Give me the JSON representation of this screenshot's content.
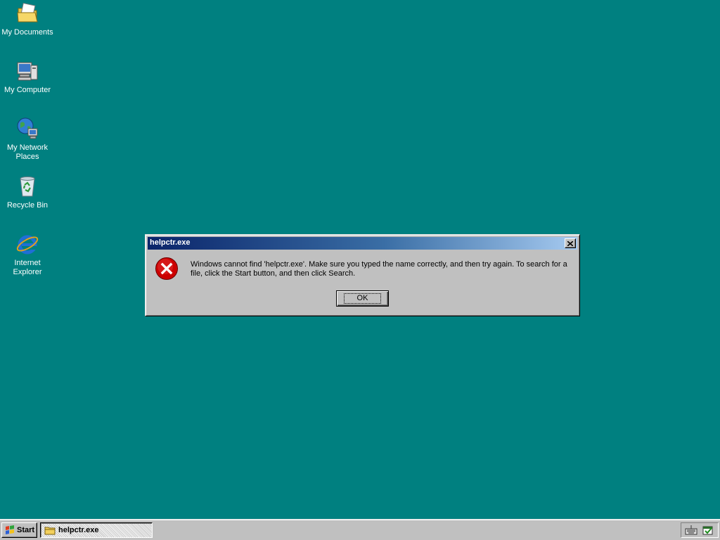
{
  "desktop": {
    "background_color": "#008080",
    "icons": [
      {
        "label": "My Documents",
        "icon": "folder-documents-icon"
      },
      {
        "label": "My Computer",
        "icon": "computer-icon"
      },
      {
        "label": "My Network\nPlaces",
        "icon": "network-globe-icon"
      },
      {
        "label": "Recycle Bin",
        "icon": "recycle-bin-icon"
      },
      {
        "label": "Internet\nExplorer",
        "icon": "internet-explorer-icon"
      }
    ]
  },
  "dialog": {
    "title": "helpctr.exe",
    "icon": "error-x-icon",
    "message": "Windows cannot find 'helpctr.exe'. Make sure you typed the name correctly, and then try again. To search for a file, click the Start button, and then click Search.",
    "ok_label": "OK",
    "close_icon": "close-icon",
    "title_gradient": [
      "#0a246a",
      "#a6caf0"
    ],
    "error_color": "#cc0000"
  },
  "taskbar": {
    "start_label": "Start",
    "start_icon": "windows-logo-icon",
    "task_label": "helpctr.exe",
    "task_icon": "folder-icon",
    "tray_icons": [
      "keyboard-icon",
      "scheduler-icon"
    ]
  }
}
